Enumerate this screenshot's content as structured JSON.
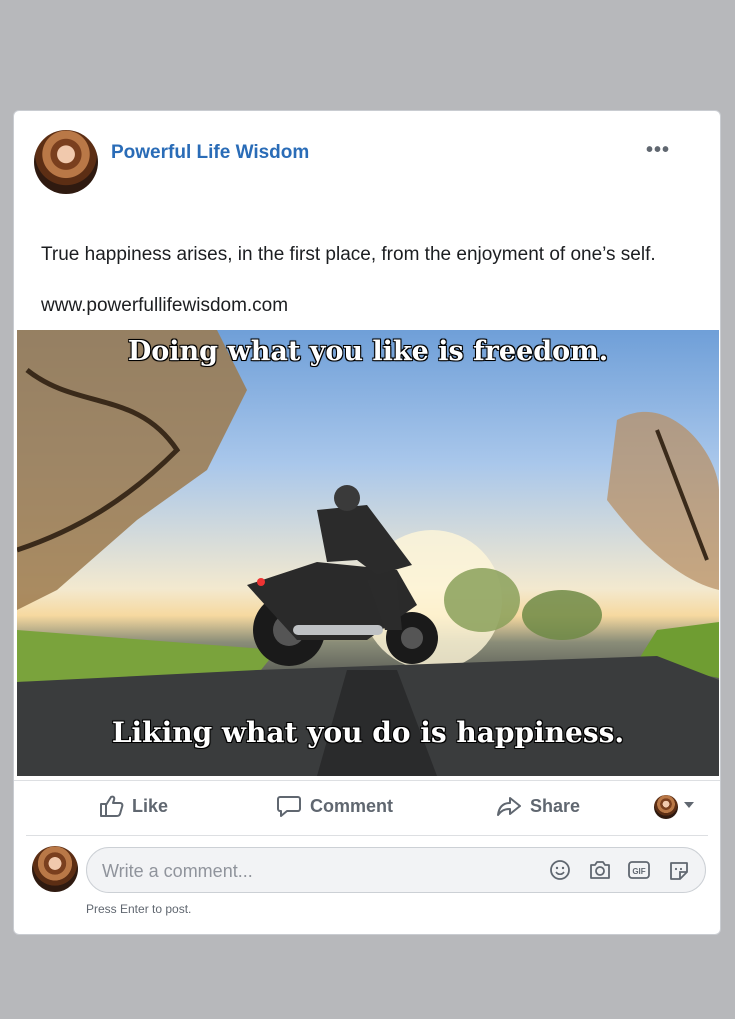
{
  "post": {
    "page_name": "Powerful Life Wisdom",
    "menu_icon": "more-dots-icon",
    "text": "True happiness arises, in the first place, from the enjoyment of one’s self.",
    "link": "www.powerfullifewisdom.com"
  },
  "image": {
    "top_caption": "Doing what you like is freedom.",
    "bottom_caption": "Liking what you do is happiness.",
    "scene": "motorcycle-sunset-photo"
  },
  "actions": {
    "like": "Like",
    "comment": "Comment",
    "share": "Share"
  },
  "comment": {
    "placeholder": "Write a comment...",
    "hint": "Press Enter to post."
  },
  "colors": {
    "page_name": "#2a6cb7",
    "action_text": "#606770"
  }
}
